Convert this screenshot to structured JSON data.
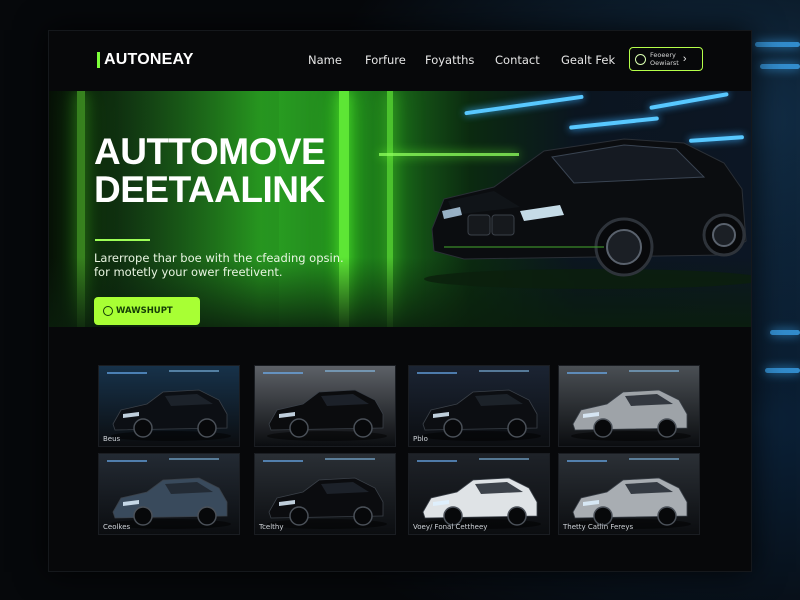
{
  "brand": {
    "name": "AUTONEAY",
    "accent": "#a8ff34"
  },
  "nav": {
    "links": [
      "Name",
      "Forfure",
      "Foyatths",
      "Contact",
      "Gealt Fek"
    ],
    "cta": {
      "line1": "Feoeery",
      "line2": "Oewiarst",
      "arrow": "›"
    }
  },
  "hero": {
    "title_line1": "AUTTOMOVE",
    "title_line2": "DEETAALINK",
    "description": "Larerrope thar boe with the cfeading opsin. for motetly your ower freetivent.",
    "button_label": "WAWSHUPT",
    "button_icon": "phone-icon"
  },
  "gallery": {
    "tiles": [
      {
        "caption": "Beus",
        "car_color": "#0c0f14",
        "scene": "#17324a"
      },
      {
        "caption": "",
        "car_color": "#0b0c0e",
        "scene": "#5d6167"
      },
      {
        "caption": "Pblo",
        "car_color": "#0c0e12",
        "scene": "#1b2433"
      },
      {
        "caption": "",
        "car_color": "#9ea3a8",
        "scene": "#4a4f54"
      },
      {
        "caption": "Ceolkes",
        "car_color": "#394a5c",
        "scene": "#232a33"
      },
      {
        "caption": "Tcelthy",
        "car_color": "#0b0c0f",
        "scene": "#2a2f35"
      },
      {
        "caption": "Voey/ Fonal Cettheey",
        "car_color": "#dfe3e6",
        "scene": "#1e2228"
      },
      {
        "caption": "Thetty Catlin Fereys",
        "car_color": "#a8adb2",
        "scene": "#2b3036"
      }
    ]
  }
}
